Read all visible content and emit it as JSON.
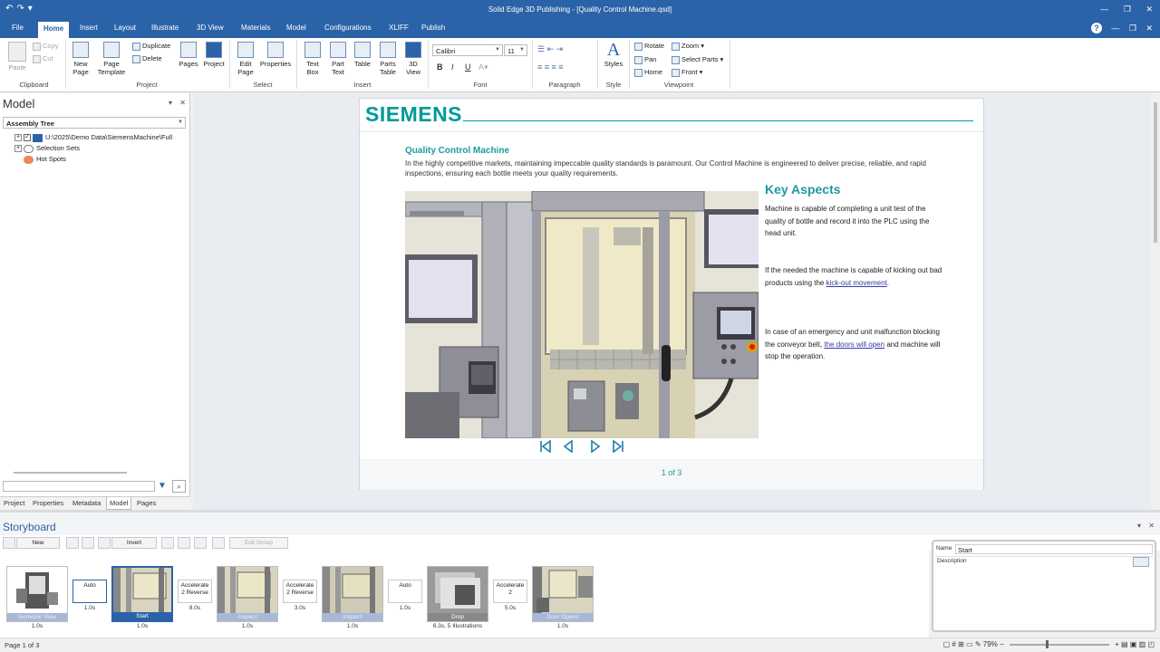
{
  "window": {
    "title": "Solid Edge 3D Publishing  - [Quality Control Machine.qsd]"
  },
  "menu": {
    "tabs": [
      "File",
      "Home",
      "Insert",
      "Layout",
      "Illustrate",
      "3D View",
      "Materials",
      "Model",
      "Configurations",
      "XLIFF",
      "Publish"
    ],
    "active": "Home"
  },
  "ribbon": {
    "clipboard": {
      "paste": "Paste",
      "copy": "Copy",
      "cut": "Cut",
      "group": "Clipboard"
    },
    "project": {
      "new_page": "New\nPage",
      "page_template": "Page\nTemplate",
      "duplicate": "Duplicate",
      "delete": "Delete",
      "pages": "Pages",
      "project": "Project",
      "group": "Project"
    },
    "select": {
      "edit_page": "Edit\nPage",
      "properties": "Properties",
      "group": "Select"
    },
    "insert": {
      "text_box": "Text\nBox",
      "part_text": "Part\nText",
      "table": "Table",
      "parts_table": "Parts\nTable",
      "view_3d": "3D\nView",
      "group": "Insert"
    },
    "font": {
      "family": "Calibri",
      "size": "11",
      "bold": "B",
      "italic": "I",
      "underline": "U",
      "group": "Font"
    },
    "paragraph": {
      "group": "Paragraph"
    },
    "style": {
      "styles": "Styles",
      "group": "Style"
    },
    "viewpoint": {
      "rotate": "Rotate",
      "zoom": "Zoom",
      "pan": "Pan",
      "select_parts": "Select Parts",
      "home": "Home",
      "front": "Front",
      "group": "Viewpoint"
    }
  },
  "left_panel": {
    "title": "Model",
    "combo": "Assembly Tree",
    "tree": [
      {
        "label": "U:\\2025\\Demo Data\\SiemensMachine\\Full"
      },
      {
        "label": "Selection Sets"
      },
      {
        "label": "Hot Spots"
      }
    ],
    "tabs": [
      "Project",
      "Properties",
      "Metadata",
      "Model",
      "Pages"
    ],
    "active_tab": "Model"
  },
  "document": {
    "brand": "SIEMENS",
    "heading": "Quality Control Machine",
    "intro": "In the highly competitive markets, maintaining impeccable quality standards is paramount. Our Control Machine is engineered to deliver precise, reliable, and rapid inspections, ensuring each bottle meets your quality requirements.",
    "key_title": "Key Aspects",
    "p1": "Machine is capable of completing a unit test of the quality of bottle and record it into the PLC using the head unit.",
    "p2_pre": "If the needed the machine is capable of kicking out bad products using the ",
    "p2_link": "kick-out movement",
    "p2_post": ".",
    "p3_pre": "In case of an emergency and unit malfunction blocking the conveyor belt, ",
    "p3_link": "the doors will open",
    "p3_post": " and machine will stop the operation.",
    "page_indicator": "1 of 3"
  },
  "storyboard": {
    "title": "Storyboard",
    "toolbar": {
      "new": "New",
      "invert": "Invert",
      "edit_group": "Edit Group"
    },
    "frames": [
      {
        "caption": "Isometric View",
        "time": "1.0s"
      },
      {
        "caption": "Start",
        "time": "1.0s"
      },
      {
        "caption": "Inspect",
        "time": "1.0s"
      },
      {
        "caption": "Inspect",
        "time": "1.0s"
      },
      {
        "caption": "Drop",
        "time": "6.3s, 5 Illustrations"
      },
      {
        "caption": "Door Opens",
        "time": "1.0s"
      }
    ],
    "transitions": [
      {
        "label": "Auto",
        "time": "1.0s"
      },
      {
        "label": "Accelerate 2 Reverse",
        "time": "8.0s"
      },
      {
        "label": "Accelerate 2 Reverse",
        "time": "3.0s"
      },
      {
        "label": "Auto",
        "time": "1.0s"
      },
      {
        "label": "Accelerate 2",
        "time": "5.0s"
      }
    ],
    "name_label": "Name",
    "name_value": "Start",
    "description_label": "Description"
  },
  "status": {
    "page": "Page 1 of 3",
    "zoom": "79%"
  }
}
